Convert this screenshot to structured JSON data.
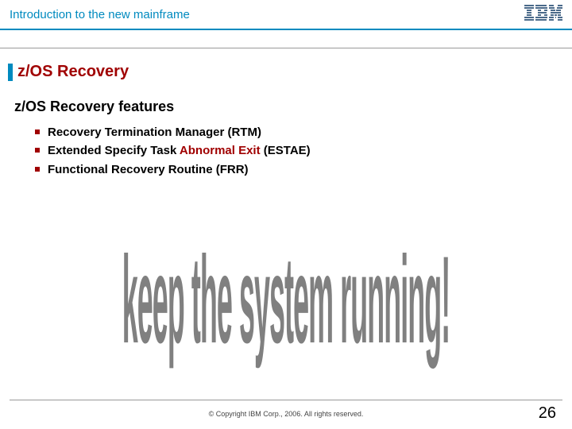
{
  "header": {
    "title": "Introduction to the new mainframe",
    "logo_name": "ibm-logo"
  },
  "slide": {
    "title": "z/OS Recovery",
    "subtitle": "z/OS Recovery features",
    "bullets": [
      {
        "plain": "Recovery Termination Manager (RTM)"
      },
      {
        "plain_before": "Extended Specify Task ",
        "accent": "Abnormal Exit",
        "plain_after": " (ESTAE)"
      },
      {
        "plain": "Functional Recovery Routine (FRR)"
      }
    ],
    "big_text": "keep the system running!"
  },
  "footer": {
    "copyright": "© Copyright IBM Corp., 2006. All rights reserved.",
    "page": "26"
  }
}
